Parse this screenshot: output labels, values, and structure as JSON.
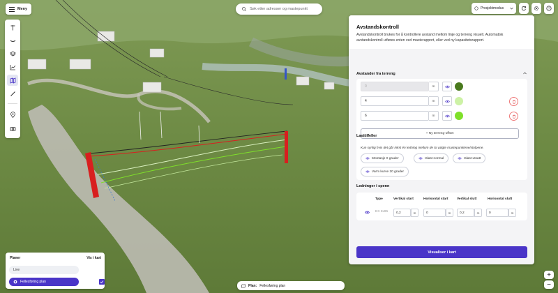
{
  "header": {
    "menu_label": "Meny",
    "search_placeholder": "Søk etter adresser og mastepunkt",
    "mode_label": "Prosjektmodus"
  },
  "icons": {
    "menu": "hamburger-icon",
    "search": "search-icon",
    "mode": "project-icon",
    "refresh": "sync-icon",
    "settings": "gear-icon",
    "help": "help-icon",
    "eye": "eye-icon",
    "trash": "trash-icon"
  },
  "toolbar": {
    "tools": [
      "mast-icon",
      "line-icon",
      "layers-icon",
      "chart-icon",
      "map-icon",
      "ruler-icon",
      "location-pin-icon",
      "camera-icon"
    ]
  },
  "panel": {
    "title": "Avstandskontroll",
    "description": "Avstandskontroll brukes for å kontrollere avstand mellom linje og terreng visuelt. Automatisk avstandskontroll utføres enten ved masterapport, eller ved ny kapasitetsrapport.",
    "distance_section_title": "Avstander fra terreng",
    "distance_rows": [
      {
        "value": "0",
        "unit": "m",
        "color": "#4a7a1e",
        "removable": false
      },
      {
        "value": "4",
        "unit": "m",
        "color": "#cdf2a6",
        "removable": true
      },
      {
        "value": "6",
        "unit": "m",
        "color": "#7fe02a",
        "removable": true
      }
    ],
    "add_offset_label": "+ Ny terreng-offset",
    "load_section_title": "Lasttilfeller",
    "load_note": "Kun synlig hvis det går inkst én ledning mellom de to valgte mastepunktene/stolpene.",
    "load_cases": [
      "Montasje 0 grader",
      "Islast normal",
      "Islast utsatt",
      "Varm kurve 20 grader"
    ],
    "conductors_section_title": "Ledninger i spenn",
    "table_headers": [
      "Type",
      "Vertikal start",
      "Horisontal start",
      "Vertikal slutt",
      "Horisontal slutt"
    ],
    "conductor_row": {
      "type": "EX 3x95",
      "vertical_start": "0,2",
      "horizontal_start": "0",
      "vertical_end": "0,2",
      "horizontal_end": "0",
      "unit": "m"
    },
    "visualize_label": "Visualiser i kart"
  },
  "plans": {
    "title": "Planer",
    "show_label": "Vis i kart",
    "items": [
      {
        "label": "Live",
        "active": false
      },
      {
        "label": "Fellesføring plan",
        "active": true
      }
    ]
  },
  "plan_badge": {
    "prefix": "Plan:",
    "value": "Fellesføring plan"
  },
  "zoom": {
    "in": "+",
    "out": "−"
  },
  "colors": {
    "accent": "#4a35c8",
    "mast": "#d81f1f",
    "trash": "#e05555"
  }
}
